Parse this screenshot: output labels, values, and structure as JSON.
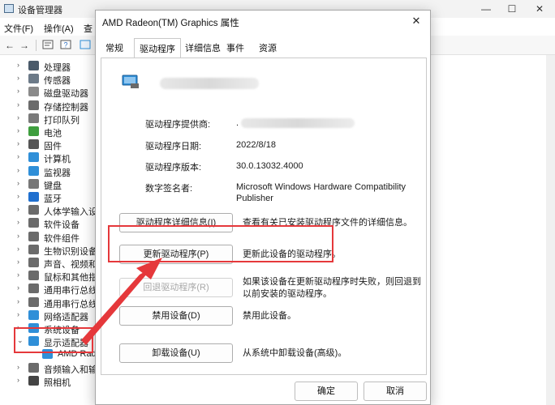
{
  "colors": {
    "annotation": "#e5383b",
    "display_icon": "#2f8fd8"
  },
  "device_manager": {
    "title": "设备管理器",
    "window_controls": {
      "minimize": "—",
      "maximize": "☐",
      "close": "✕"
    },
    "menu": [
      "文件(F)",
      "操作(A)",
      "查"
    ],
    "toolbar_icons": [
      "back-arrow-icon",
      "forward-arrow-icon",
      "properties-icon",
      "help-icon",
      "update-icon"
    ],
    "tree": [
      {
        "label": "处理器",
        "icon": "cpu-icon",
        "color": "#4a5a6a"
      },
      {
        "label": "传感器",
        "icon": "sensor-icon",
        "color": "#6c7a88"
      },
      {
        "label": "磁盘驱动器",
        "icon": "disk-icon",
        "color": "#8a8a8a"
      },
      {
        "label": "存储控制器",
        "icon": "storage-icon",
        "color": "#6b6b6b"
      },
      {
        "label": "打印队列",
        "icon": "printer-icon",
        "color": "#7a7a7a"
      },
      {
        "label": "电池",
        "icon": "battery-icon",
        "color": "#3e9e3e"
      },
      {
        "label": "固件",
        "icon": "firmware-icon",
        "color": "#555"
      },
      {
        "label": "计算机",
        "icon": "computer-icon",
        "color": "#2f8fd8"
      },
      {
        "label": "监视器",
        "icon": "monitor-icon",
        "color": "#2f8fd8"
      },
      {
        "label": "键盘",
        "icon": "keyboard-icon",
        "color": "#777"
      },
      {
        "label": "蓝牙",
        "icon": "bluetooth-icon",
        "color": "#1f6fcf"
      },
      {
        "label": "人体学输入设",
        "icon": "hid-icon",
        "color": "#6b6b6b"
      },
      {
        "label": "软件设备",
        "icon": "software-device-icon",
        "color": "#6b6b6b"
      },
      {
        "label": "软件组件",
        "icon": "software-component-icon",
        "color": "#6b6b6b"
      },
      {
        "label": "生物识别设备",
        "icon": "biometric-icon",
        "color": "#6b6b6b"
      },
      {
        "label": "声音、视频和",
        "icon": "speaker-icon",
        "color": "#6b6b6b"
      },
      {
        "label": "鼠标和其他指",
        "icon": "mouse-icon",
        "color": "#6b6b6b"
      },
      {
        "label": "通用串行总线",
        "icon": "usb-icon",
        "color": "#6b6b6b"
      },
      {
        "label": "通用串行总线",
        "icon": "usb-icon",
        "color": "#6b6b6b"
      },
      {
        "label": "网络适配器",
        "icon": "network-icon",
        "color": "#2f8fd8"
      },
      {
        "label": "系统设备",
        "icon": "system-icon",
        "color": "#2f8fd8"
      },
      {
        "label": "显示适配器",
        "icon": "display-adapter-icon",
        "color": "#2f8fd8"
      },
      {
        "label": "AMD Rade",
        "icon": "display-adapter-icon",
        "color": "#2f8fd8"
      },
      {
        "label": "音频输入和输",
        "icon": "audio-io-icon",
        "color": "#6b6b6b"
      },
      {
        "label": "照相机",
        "icon": "camera-icon",
        "color": "#444"
      }
    ]
  },
  "dialog": {
    "title": "AMD Radeon(TM) Graphics 属性",
    "close": "✕",
    "tabs": [
      "常规",
      "驱动程序",
      "详细信息",
      "事件",
      "资源"
    ],
    "active_tab": "驱动程序",
    "info": [
      {
        "label": "驱动程序提供商:",
        "value": "."
      },
      {
        "label": "驱动程序日期:",
        "value": "2022/8/18"
      },
      {
        "label": "驱动程序版本:",
        "value": "30.0.13032.4000"
      },
      {
        "label": "数字签名者:",
        "value": "Microsoft Windows Hardware Compatibility Publisher"
      }
    ],
    "actions": [
      {
        "button": "驱动程序详细信息(I)",
        "desc": "查看有关已安装驱动程序文件的详细信息。"
      },
      {
        "button": "更新驱动程序(P)",
        "desc": "更新此设备的驱动程序。"
      },
      {
        "button": "回退驱动程序(R)",
        "desc": "如果该设备在更新驱动程序时失败，则回退到以前安装的驱动程序。"
      },
      {
        "button": "禁用设备(D)",
        "desc": "禁用此设备。"
      },
      {
        "button": "卸载设备(U)",
        "desc": "从系统中卸载设备(高级)。"
      }
    ],
    "ok": "确定",
    "cancel": "取消"
  }
}
